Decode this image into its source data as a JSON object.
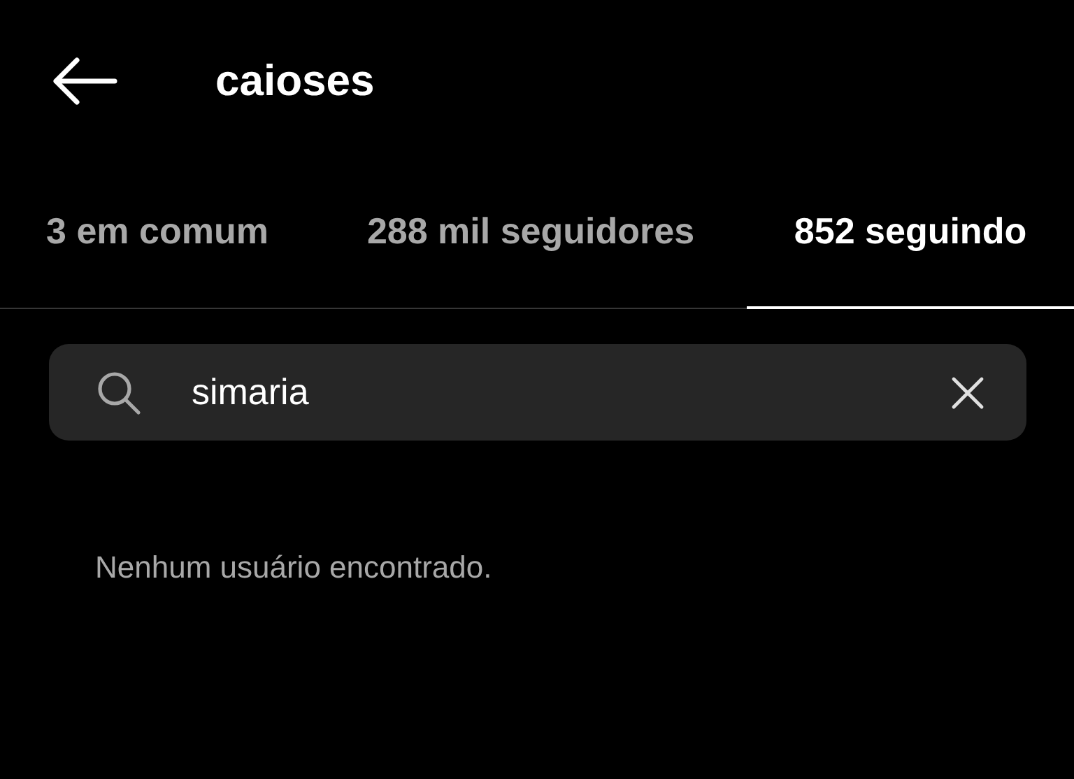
{
  "header": {
    "title": "caioses"
  },
  "tabs": [
    {
      "label": "3 em comum",
      "selected": false
    },
    {
      "label": "288 mil seguidores",
      "selected": false
    },
    {
      "label": "852 seguindo",
      "selected": true
    }
  ],
  "search": {
    "value": "simaria"
  },
  "empty_message": "Nenhum usuário encontrado."
}
